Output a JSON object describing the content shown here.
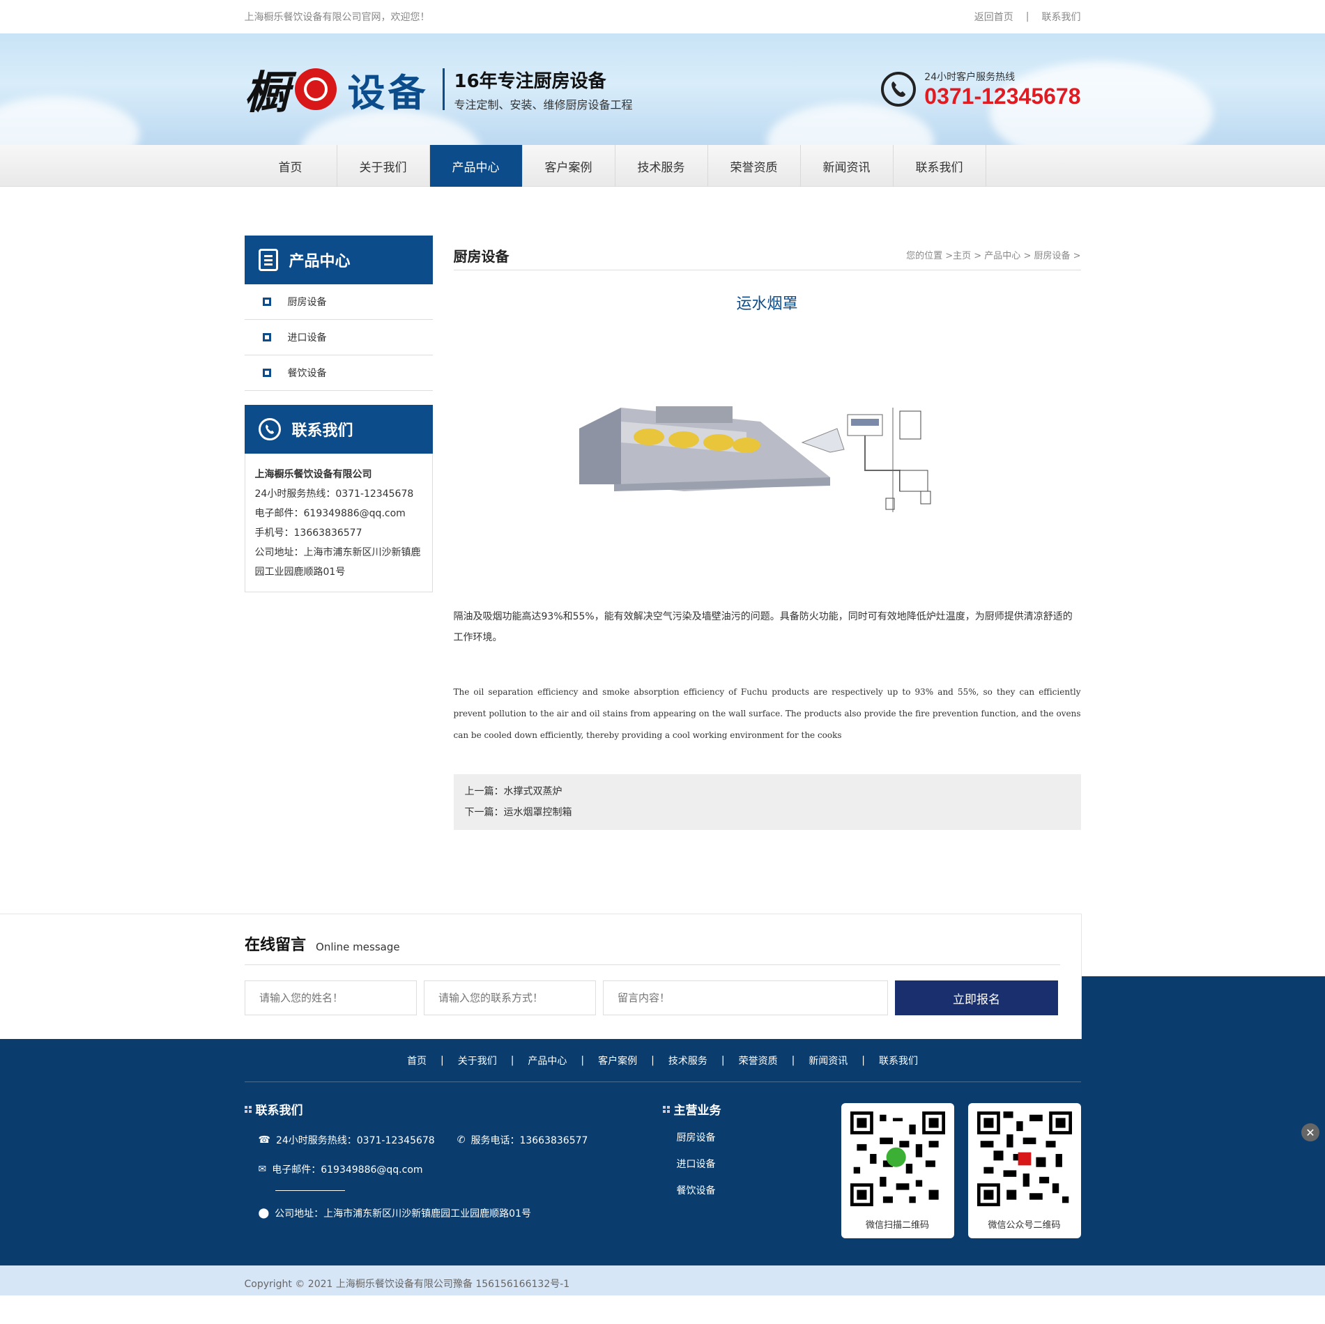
{
  "topbar": {
    "welcome": "上海橱乐餐饮设备有限公司官网，欢迎您！",
    "home_link": "返回首页",
    "separator": "|",
    "contact_link": "联系我们"
  },
  "header": {
    "logo_char": "橱",
    "logo_word": "设备",
    "slogan_main": "16年专注厨房设备",
    "slogan_sub": "专注定制、安装、维修厨房设备工程",
    "hotline_label": "24小时客户服务热线",
    "hotline_number": "0371-12345678"
  },
  "nav": {
    "items": [
      "首页",
      "关于我们",
      "产品中心",
      "客户案例",
      "技术服务",
      "荣誉资质",
      "新闻资讯",
      "联系我们"
    ],
    "active": "产品中心"
  },
  "sidebar": {
    "product_title": "产品中心",
    "categories": [
      "厨房设备",
      "进口设备",
      "餐饮设备"
    ],
    "contact_title": "联系我们",
    "company": "上海橱乐餐饮设备有限公司",
    "hotline": "24小时服务热线：0371-12345678",
    "email": "电子邮件：619349886@qq.com",
    "mobile": "手机号：13663836577",
    "address": "公司地址：上海市浦东新区川沙新镇鹿园工业园鹿顺路01号"
  },
  "content": {
    "section_title": "厨房设备",
    "breadcrumb": "您的位置 >主页 > 产品中心 > 厨房设备 >",
    "product_title": "运水烟罩",
    "desc_cn": "隔油及吸烟功能高达93%和55%，能有效解决空气污染及墙壁油污的问题。具备防火功能，同时可有效地降低炉灶温度，为厨师提供清凉舒适的工作环境。",
    "desc_en": "The oil separation efficiency and smoke absorption efficiency of Fuchu products are respectively up to 93% and 55%, so they can efficiently prevent pollution to the air and oil stains from appearing on the wall surface. The products also provide the fire prevention function, and the ovens can be cooled down efficiently, thereby providing a cool working environment for the cooks",
    "prev": "上一篇：水撑式双蒸炉",
    "next": "下一篇：运水烟罩控制箱"
  },
  "message": {
    "title": "在线留言",
    "subtitle": "Online message",
    "name_placeholder": "请输入您的姓名！",
    "contact_placeholder": "请输入您的联系方式！",
    "content_placeholder": "留言内容！",
    "submit": "立即报名"
  },
  "footer": {
    "nav": [
      "首页",
      "关于我们",
      "产品中心",
      "客户案例",
      "技术服务",
      "荣誉资质",
      "新闻资讯",
      "联系我们"
    ],
    "contact_title": "联系我们",
    "hotline": "24小时服务热线：0371-12345678",
    "service_phone": "服务电话：13663836577",
    "email": "电子邮件：619349886@qq.com",
    "address": "公司地址：上海市浦东新区川沙新镇鹿园工业园鹿顺路01号",
    "biz_title": "主营业务",
    "biz_items": [
      "厨房设备",
      "进口设备",
      "餐饮设备"
    ],
    "qr1_caption": "微信扫描二维码",
    "qr2_caption": "微信公众号二维码",
    "copyright": "Copyright © 2021 上海橱乐餐饮设备有限公司豫备 156156166132号-1"
  },
  "colors": {
    "brand_blue": "#0d4c8b",
    "footer_blue": "#0a3d6e",
    "hotline_red": "#e01b22",
    "button_navy": "#1a2f6d"
  }
}
